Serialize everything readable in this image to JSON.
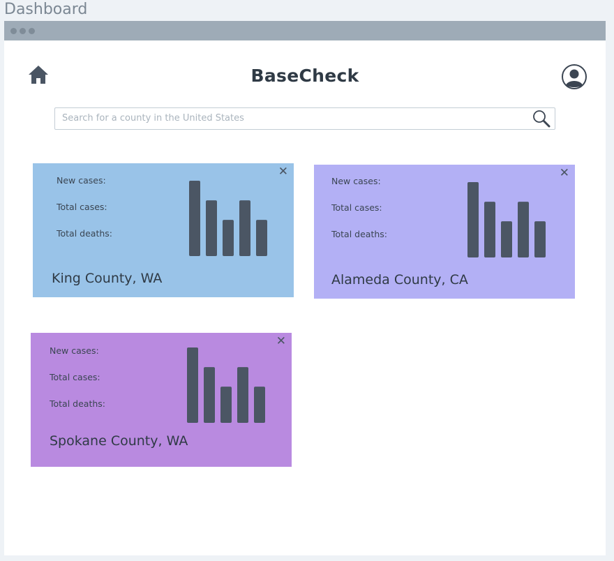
{
  "page_label": "Dashboard",
  "app": {
    "title": "BaseCheck"
  },
  "search": {
    "placeholder": "Search for a county in the United States",
    "value": ""
  },
  "colors": {
    "card_king": "#99c3e8",
    "card_alameda": "#b3b0f5",
    "card_spokane": "#b98ae0",
    "bars": "#4b5664"
  },
  "icons": {
    "home": "home-icon",
    "user": "user-icon",
    "search": "search-icon",
    "close": "close-icon"
  },
  "cards": [
    {
      "county": "King County, WA",
      "labels": {
        "new_cases": "New cases:",
        "total_cases": "Total cases:",
        "total_deaths": "Total deaths:"
      },
      "close_label": "✕",
      "bar_levels": [
        1.0,
        0.74,
        0.48,
        0.74,
        0.48
      ]
    },
    {
      "county": "Alameda County, CA",
      "labels": {
        "new_cases": "New cases:",
        "total_cases": "Total cases:",
        "total_deaths": "Total deaths:"
      },
      "close_label": "✕",
      "bar_levels": [
        1.0,
        0.74,
        0.48,
        0.74,
        0.48
      ]
    },
    {
      "county": "Spokane County, WA",
      "labels": {
        "new_cases": "New cases:",
        "total_cases": "Total cases:",
        "total_deaths": "Total deaths:"
      },
      "close_label": "✕",
      "bar_levels": [
        1.0,
        0.74,
        0.48,
        0.74,
        0.48
      ]
    }
  ]
}
